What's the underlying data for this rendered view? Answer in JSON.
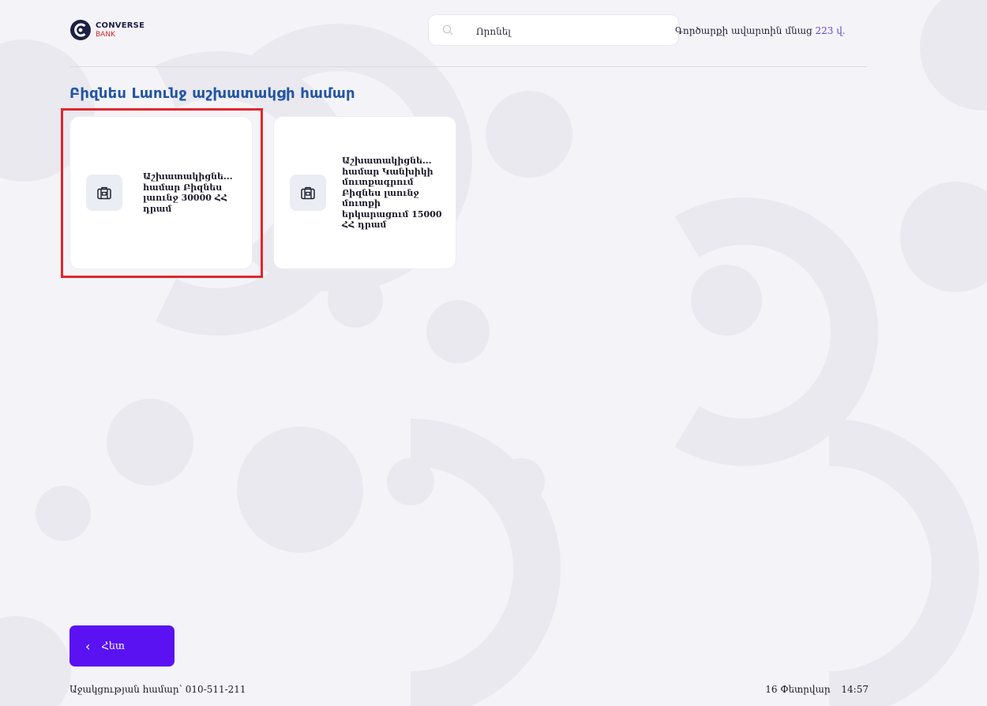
{
  "brand": {
    "name": "CONVERSE",
    "sub": "BANK",
    "primary_color": "#1c2045",
    "accent_color": "#d0262d"
  },
  "search": {
    "placeholder": "Որոնել",
    "icon": "search-icon"
  },
  "session": {
    "prefix": "Գործարքի ավարտին մնաց",
    "seconds": "223 վ."
  },
  "page": {
    "title": "Բիզնես Լաունջ աշխատակցի համար"
  },
  "cards": [
    {
      "label": "Աշխատակիցնե... համար Բիզնես լաունջ 30000 ՀՀ դրամ",
      "icon": "briefcase-icon",
      "highlighted": true
    },
    {
      "label": "Աշխատակիցնե... համար Կանխիկի մուտքագրում Բիզնես լաունջ մուտքի երկարացում 15000 ՀՀ դրամ",
      "icon": "briefcase-icon",
      "highlighted": false
    }
  ],
  "footer": {
    "back_label": "Հետ",
    "back_icon": "chevron-left-icon",
    "back_color": "#5a12f2",
    "support": "Աջակցության համար՝ 010-511-211",
    "date": "16 Փետրվար",
    "time": "14:57"
  },
  "highlight_color": "#e3262b"
}
